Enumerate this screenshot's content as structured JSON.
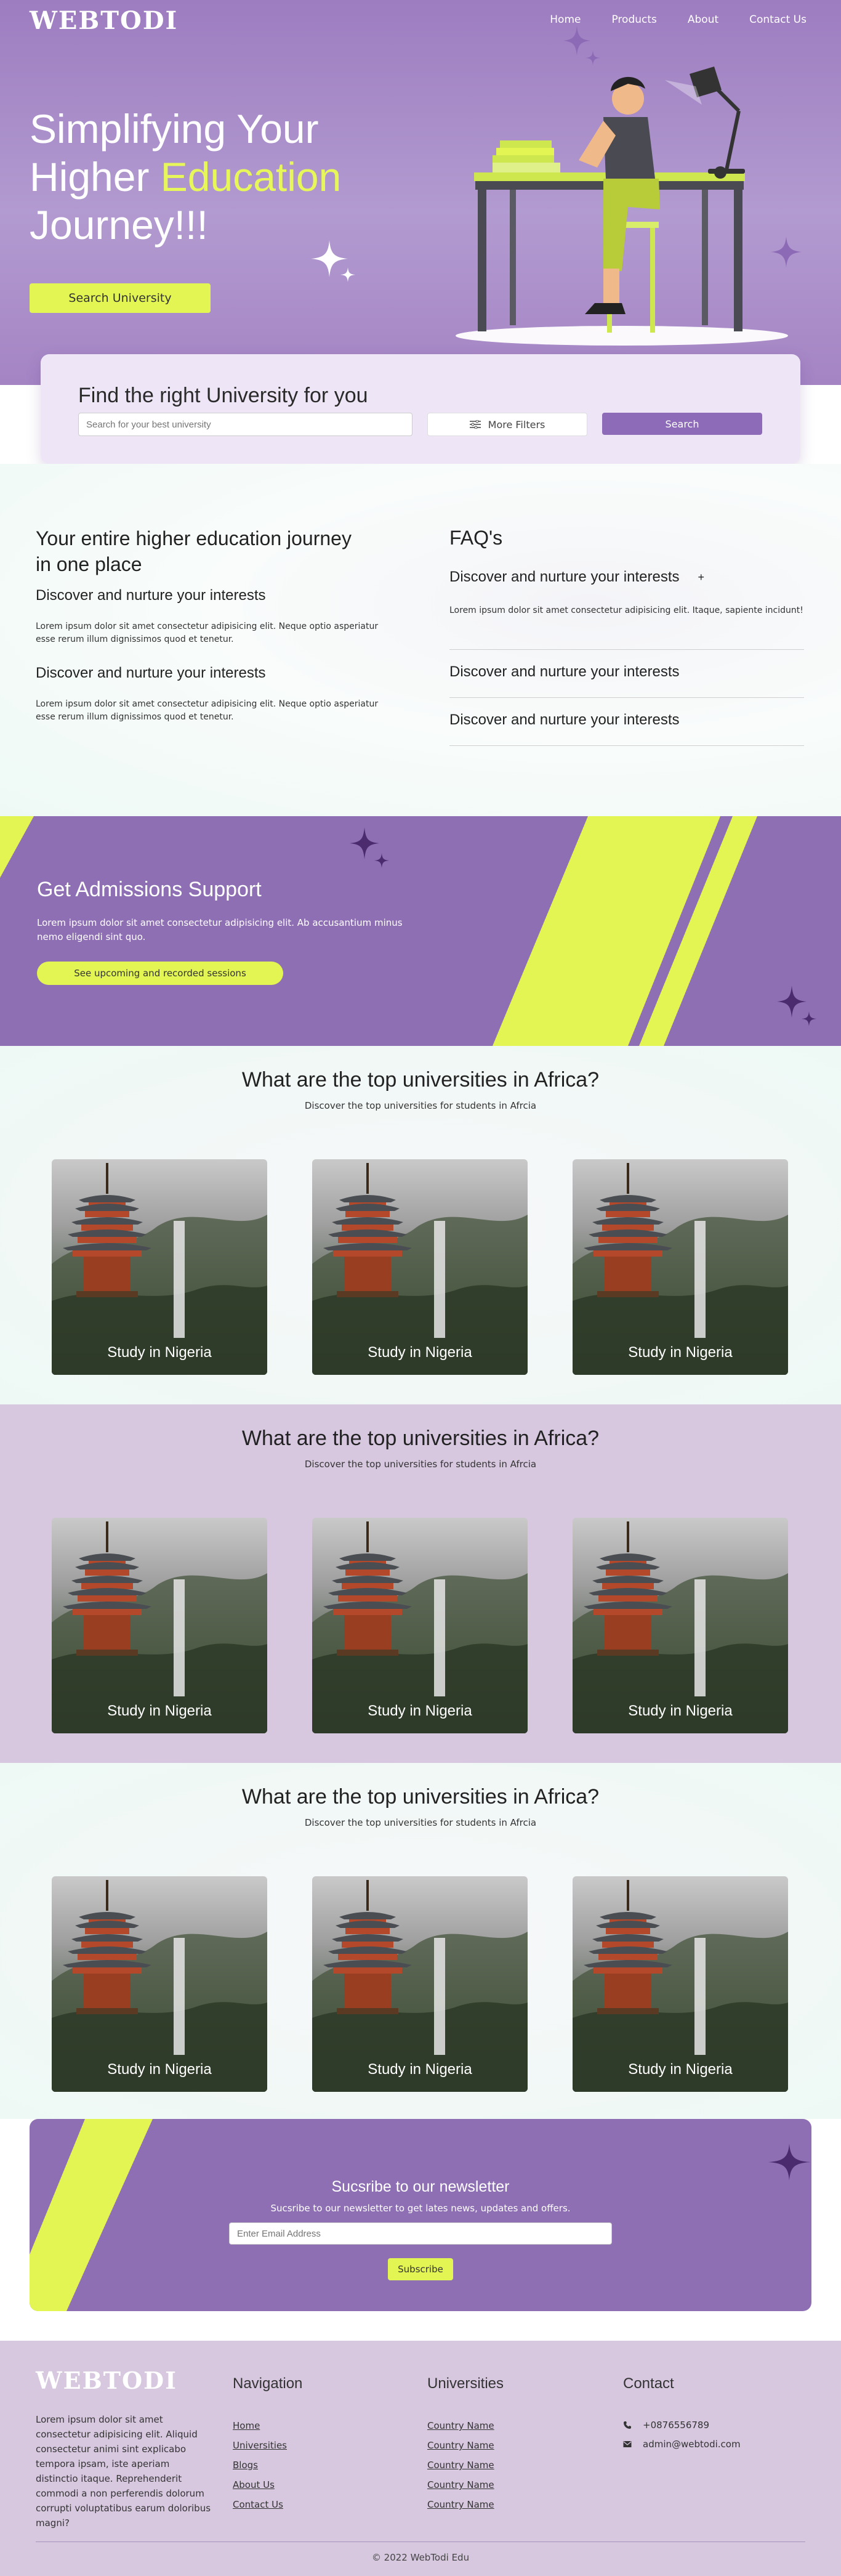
{
  "header": {
    "logo": "WEBTODI",
    "nav": [
      "Home",
      "Products",
      "About",
      "Contact Us"
    ]
  },
  "hero": {
    "title_line1": "Simplifying Your",
    "title_line2_a": "Higher ",
    "title_line2_b": "Education",
    "title_line3": "Journey!!!",
    "button": "Search University"
  },
  "search": {
    "title": "Find the right University for you",
    "placeholder": "Search for your best university",
    "filters_label": "More Filters",
    "search_label": "Search"
  },
  "info": {
    "title": "Your entire higher education journey in one place",
    "blocks": [
      {
        "heading": "Discover and nurture your interests",
        "text": "Lorem ipsum dolor sit amet consectetur adipisicing elit. Neque optio asperiatur esse rerum illum dignissimos quod et tenetur."
      },
      {
        "heading": "Discover and nurture your interests",
        "text": "Lorem ipsum dolor sit amet consectetur adipisicing elit. Neque optio asperiatur esse rerum illum dignissimos quod et tenetur."
      }
    ]
  },
  "faq": {
    "title": "FAQ's",
    "items": [
      {
        "q": "Discover and nurture your interests",
        "toggle": "+",
        "a": "Lorem ipsum dolor sit amet consectetur adipisicing elit. Itaque, sapiente incidunt!"
      },
      {
        "q": "Discover and nurture your interests"
      },
      {
        "q": "Discover and nurture your interests"
      }
    ]
  },
  "admissions": {
    "title": "Get Admissions Support",
    "text": "Lorem ipsum dolor sit amet consectetur adipisicing elit. Ab accusantium minus nemo eligendi sint quo.",
    "button": "See upcoming and recorded sessions"
  },
  "universities": [
    {
      "title": "What are the top universities in Africa?",
      "subtitle": "Discover the top universities for students in Afrcia",
      "cards": [
        "Study in Nigeria",
        "Study in Nigeria",
        "Study in Nigeria"
      ]
    },
    {
      "title": "What are the top universities in Africa?",
      "subtitle": "Discover the top universities for students in Afrcia",
      "cards": [
        "Study in Nigeria",
        "Study in Nigeria",
        "Study in Nigeria"
      ]
    },
    {
      "title": "What are the top universities in Africa?",
      "subtitle": "Discover the top universities for students in Afrcia",
      "cards": [
        "Study in Nigeria",
        "Study in Nigeria",
        "Study in Nigeria"
      ]
    }
  ],
  "newsletter": {
    "title": "Sucsribe to our newsletter",
    "subtitle": "Sucsribe to our newsletter to get lates news, updates and offers.",
    "placeholder": "Enter Email Address",
    "button": "Subscribe"
  },
  "footer": {
    "logo": "WEBTODI",
    "about": "Lorem ipsum dolor sit amet consectetur adipisicing elit. Aliquid consectetur animi sint explicabo tempora ipsam, iste aperiam distinctio itaque. Reprehenderit commodi a non perferendis dolorum corrupti voluptatibus earum doloribus magni?",
    "navigation_title": "Navigation",
    "navigation": [
      "Home",
      "Universities",
      "Blogs",
      "About Us",
      "Contact Us"
    ],
    "universities_title": "Universities",
    "universities": [
      "Country Name",
      "Country Name",
      "Country Name",
      "Country Name",
      "Country Name"
    ],
    "contact_title": "Contact",
    "phone": "+0876556789",
    "email": "admin@webtodi.com",
    "copyright": "© 2022 WebTodi Edu"
  },
  "colors": {
    "purple": "#8e6fb3",
    "lime": "#e3f552",
    "lavender": "#d7c8e0"
  }
}
